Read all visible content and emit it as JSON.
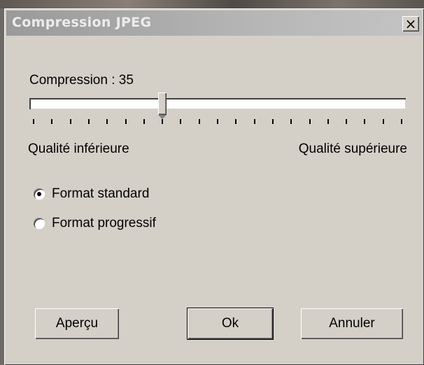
{
  "window": {
    "title": "Compression JPEG",
    "close_glyph": "×",
    "close_icon": "close-icon"
  },
  "compression": {
    "label": "Compression : 35",
    "value": 35,
    "min": 0,
    "max": 100
  },
  "quality": {
    "low_label": "Qualité inférieure",
    "high_label": "Qualité supérieure"
  },
  "format": {
    "selected": "standard",
    "options": [
      {
        "id": "standard",
        "label": "Format standard"
      },
      {
        "id": "progressif",
        "label": "Format progressif"
      }
    ]
  },
  "buttons": {
    "preview_label": "Aperçu",
    "ok_label": "Ok",
    "cancel_label": "Annuler"
  }
}
